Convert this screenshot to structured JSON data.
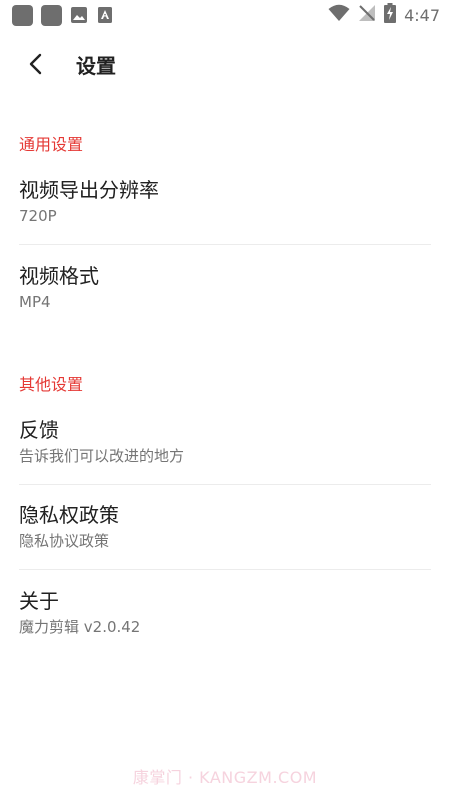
{
  "status_bar": {
    "time": "4:47",
    "icons": [
      "notification-square-icon",
      "notification-square-icon",
      "image-icon",
      "text-document-icon",
      "wifi-icon",
      "no-signal-icon",
      "battery-charging-icon"
    ]
  },
  "app_bar": {
    "back_icon": "chevron-left-icon",
    "title": "设置"
  },
  "sections": {
    "general": {
      "header": "通用设置",
      "items": [
        {
          "title": "视频导出分辨率",
          "summary": "720P"
        },
        {
          "title": "视频格式",
          "summary": "MP4"
        }
      ]
    },
    "other": {
      "header": "其他设置",
      "items": [
        {
          "title": "反馈",
          "summary": "告诉我们可以改进的地方"
        },
        {
          "title": "隐私权政策",
          "summary": "隐私协议政策"
        },
        {
          "title": "关于",
          "summary": "魔力剪辑 v2.0.42"
        }
      ]
    }
  },
  "watermark": "康掌门 · KANGZM.COM",
  "colors": {
    "accent": "#e53935",
    "status_icon": "#6e6e6e",
    "text_primary": "#212121",
    "text_secondary": "#757575"
  }
}
